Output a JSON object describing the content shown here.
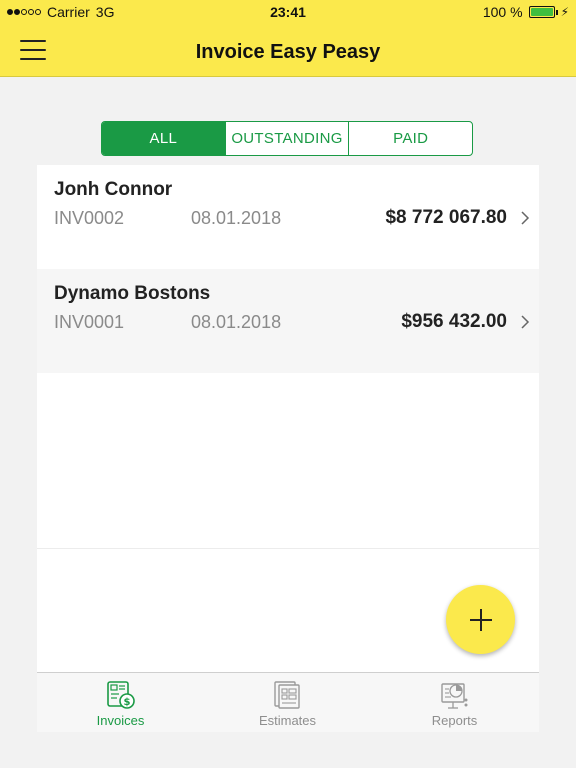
{
  "status_bar": {
    "carrier": "Carrier",
    "network": "3G",
    "time": "23:41",
    "battery": "100 %"
  },
  "header": {
    "title": "Invoice Easy Peasy"
  },
  "filter": {
    "tabs": [
      "ALL",
      "OUTSTANDING",
      "PAID"
    ],
    "selected": "ALL"
  },
  "invoices": [
    {
      "client": "Jonh Connor",
      "number": "INV0002",
      "date": "08.01.2018",
      "amount": "$8 772 067.80"
    },
    {
      "client": "Dynamo Bostons",
      "number": "INV0001",
      "date": "08.01.2018",
      "amount": "$956 432.00"
    }
  ],
  "tabbar": {
    "items": [
      "Invoices",
      "Estimates",
      "Reports"
    ],
    "selected": "Invoices"
  },
  "colors": {
    "header_yellow": "#fbe94c",
    "accent_green": "#1a9a45",
    "muted_text": "#8a8a8a"
  },
  "icons": {
    "menu": "hamburger-icon",
    "add": "plus-icon",
    "row": "chevron-right-icon"
  }
}
